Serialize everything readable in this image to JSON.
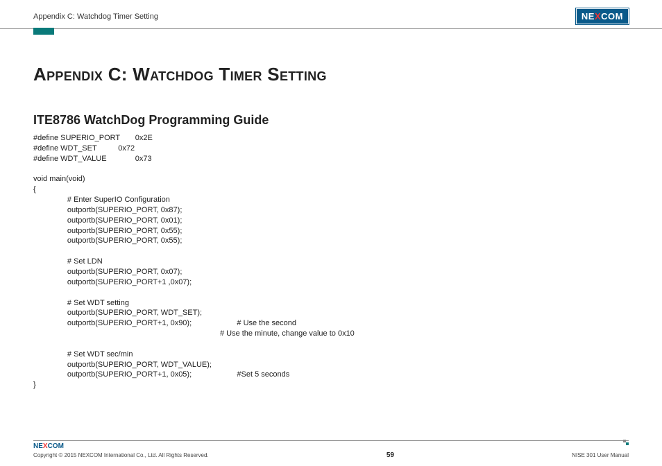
{
  "header": {
    "breadcrumb": "Appendix C: Watchdog Timer Setting",
    "logo_pre": "NE",
    "logo_x": "X",
    "logo_post": "COM"
  },
  "main": {
    "title": "Appendix C: Watchdog Timer Setting",
    "subtitle": "ITE8786 WatchDog Programming Guide",
    "code": "#define SUPERIO_PORT\t0x2E\n#define WDT_SET\t\t0x72\n#define WDT_VALUE\t\t0x73\n\nvoid main(void)\n{\n\t\t# Enter SuperIO Configuration\n\t\toutportb(SUPERIO_PORT, 0x87);\n\t\toutportb(SUPERIO_PORT, 0x01);\n\t\toutportb(SUPERIO_PORT, 0x55);\n\t\toutportb(SUPERIO_PORT, 0x55);\n\n\t\t# Set LDN\n\t\toutportb(SUPERIO_PORT, 0x07);\n\t\toutportb(SUPERIO_PORT+1 ,0x07);\n\n\t\t# Set WDT setting\n\t\toutportb(SUPERIO_PORT, WDT_SET);\n\t\toutportb(SUPERIO_PORT+1, 0x90);\t\t\t# Use the second\n\t\t\t\t\t\t\t\t\t\t\t# Use the minute, change value to 0x10\n\n\t\t# Set WDT sec/min\n\t\toutportb(SUPERIO_PORT, WDT_VALUE);\n\t\toutportb(SUPERIO_PORT+1, 0x05);\t\t\t#Set 5 seconds\n}"
  },
  "footer": {
    "logo_pre": "NE",
    "logo_x": "X",
    "logo_post": "COM",
    "copyright": "Copyright © 2015 NEXCOM International Co., Ltd. All Rights Reserved.",
    "page": "59",
    "manual": "NISE 301 User Manual"
  }
}
